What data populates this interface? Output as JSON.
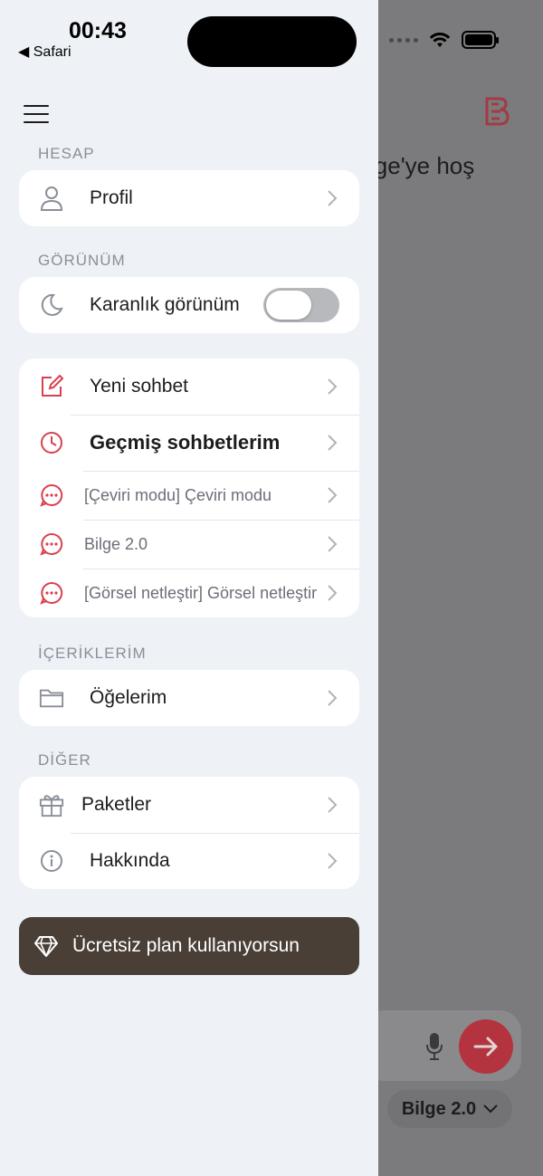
{
  "status_bar": {
    "time": "00:43",
    "back_app": "◀ Safari"
  },
  "background": {
    "welcome_text": "lge'ye hoş",
    "model_selector": "Bilge 2.0"
  },
  "sections": {
    "account": "HESAP",
    "appearance": "GÖRÜNÜM",
    "content": "İÇERİKLERİM",
    "other": "DİĞER"
  },
  "account": {
    "profile": "Profil"
  },
  "appearance": {
    "dark_mode": "Karanlık görünüm",
    "dark_mode_on": false
  },
  "chats": {
    "new_chat": "Yeni sohbet",
    "history": "Geçmiş sohbetlerim",
    "recent": [
      "[Çeviri modu] Çeviri modu",
      "Bilge 2.0",
      "[Görsel netleştir] Görsel netleştir"
    ]
  },
  "content": {
    "items": "Öğelerim"
  },
  "other": {
    "packages": "Paketler",
    "about": "Hakkında"
  },
  "plan": {
    "label": "Ücretsiz plan kullanıyorsun"
  },
  "colors": {
    "accent": "#d9404d",
    "plan_bg": "#4a3f37",
    "drawer_bg": "#eef2f7"
  }
}
